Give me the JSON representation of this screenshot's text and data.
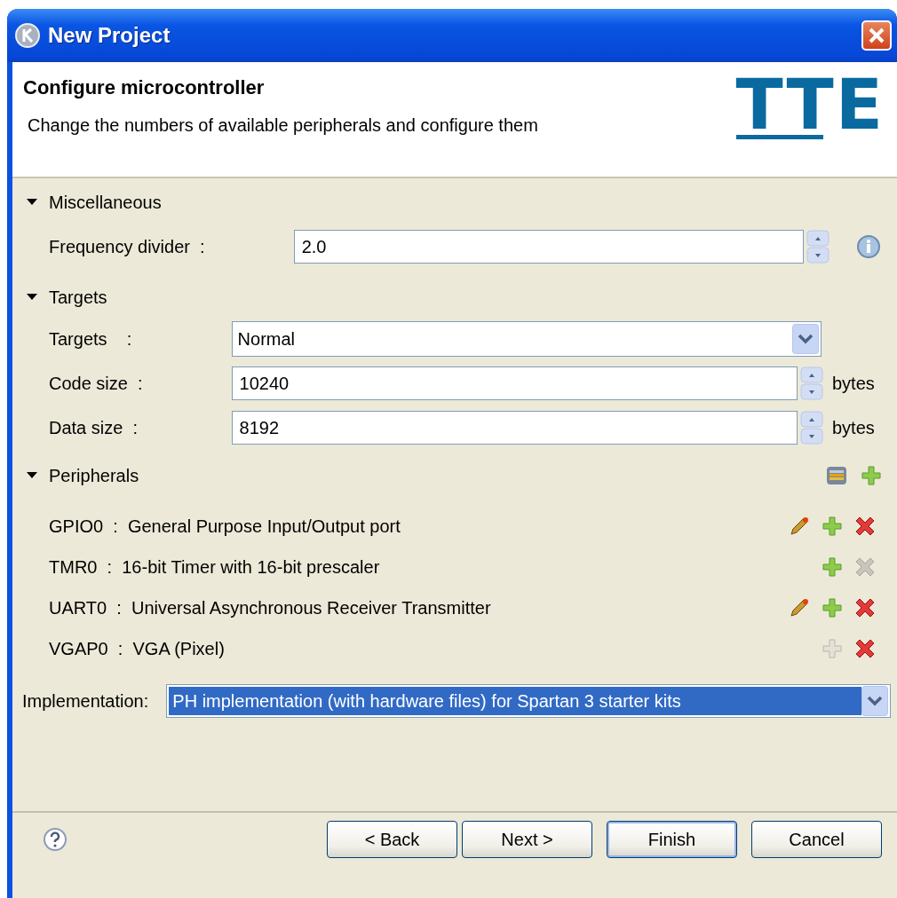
{
  "window": {
    "title": "New Project"
  },
  "header": {
    "title": "Configure microcontroller",
    "description": "Change the numbers of available peripherals and configure them",
    "logo": "TTE"
  },
  "sections": [
    {
      "title": "Miscellaneous",
      "expanded": true,
      "fields": [
        {
          "kind": "spinner",
          "label": "Frequency divider  :",
          "value": "2.0",
          "info": true
        }
      ]
    },
    {
      "title": "Targets",
      "expanded": true,
      "fields": [
        {
          "kind": "combo",
          "label": "Targets    :",
          "value": "Normal"
        },
        {
          "kind": "spinner",
          "label": "Code size  :",
          "value": "10240",
          "unit": "bytes"
        },
        {
          "kind": "spinner",
          "label": "Data size  :",
          "value": "8192",
          "unit": "bytes"
        }
      ]
    },
    {
      "title": "Peripherals",
      "expanded": true,
      "toolbar": true,
      "items": [
        {
          "text": "GPIO0  :  General Purpose Input/Output port",
          "editable": true,
          "add_enabled": true,
          "remove_enabled": true
        },
        {
          "text": "TMR0  :  16-bit Timer with 16-bit prescaler",
          "editable": false,
          "add_enabled": true,
          "remove_enabled": false
        },
        {
          "text": "UART0  :  Universal Asynchronous Receiver Transmitter",
          "editable": true,
          "add_enabled": true,
          "remove_enabled": true
        },
        {
          "text": "VGAP0  :  VGA (Pixel)",
          "editable": false,
          "add_enabled": false,
          "remove_enabled": true
        }
      ]
    }
  ],
  "implementation": {
    "label": "Implementation:",
    "value": "PH implementation (with hardware files) for Spartan 3 starter kits",
    "highlighted": true
  },
  "buttons": [
    {
      "label": "< Back",
      "default": false
    },
    {
      "label": "Next >",
      "default": false
    },
    {
      "label": "Finish",
      "default": true
    },
    {
      "label": "Cancel",
      "default": false
    }
  ]
}
